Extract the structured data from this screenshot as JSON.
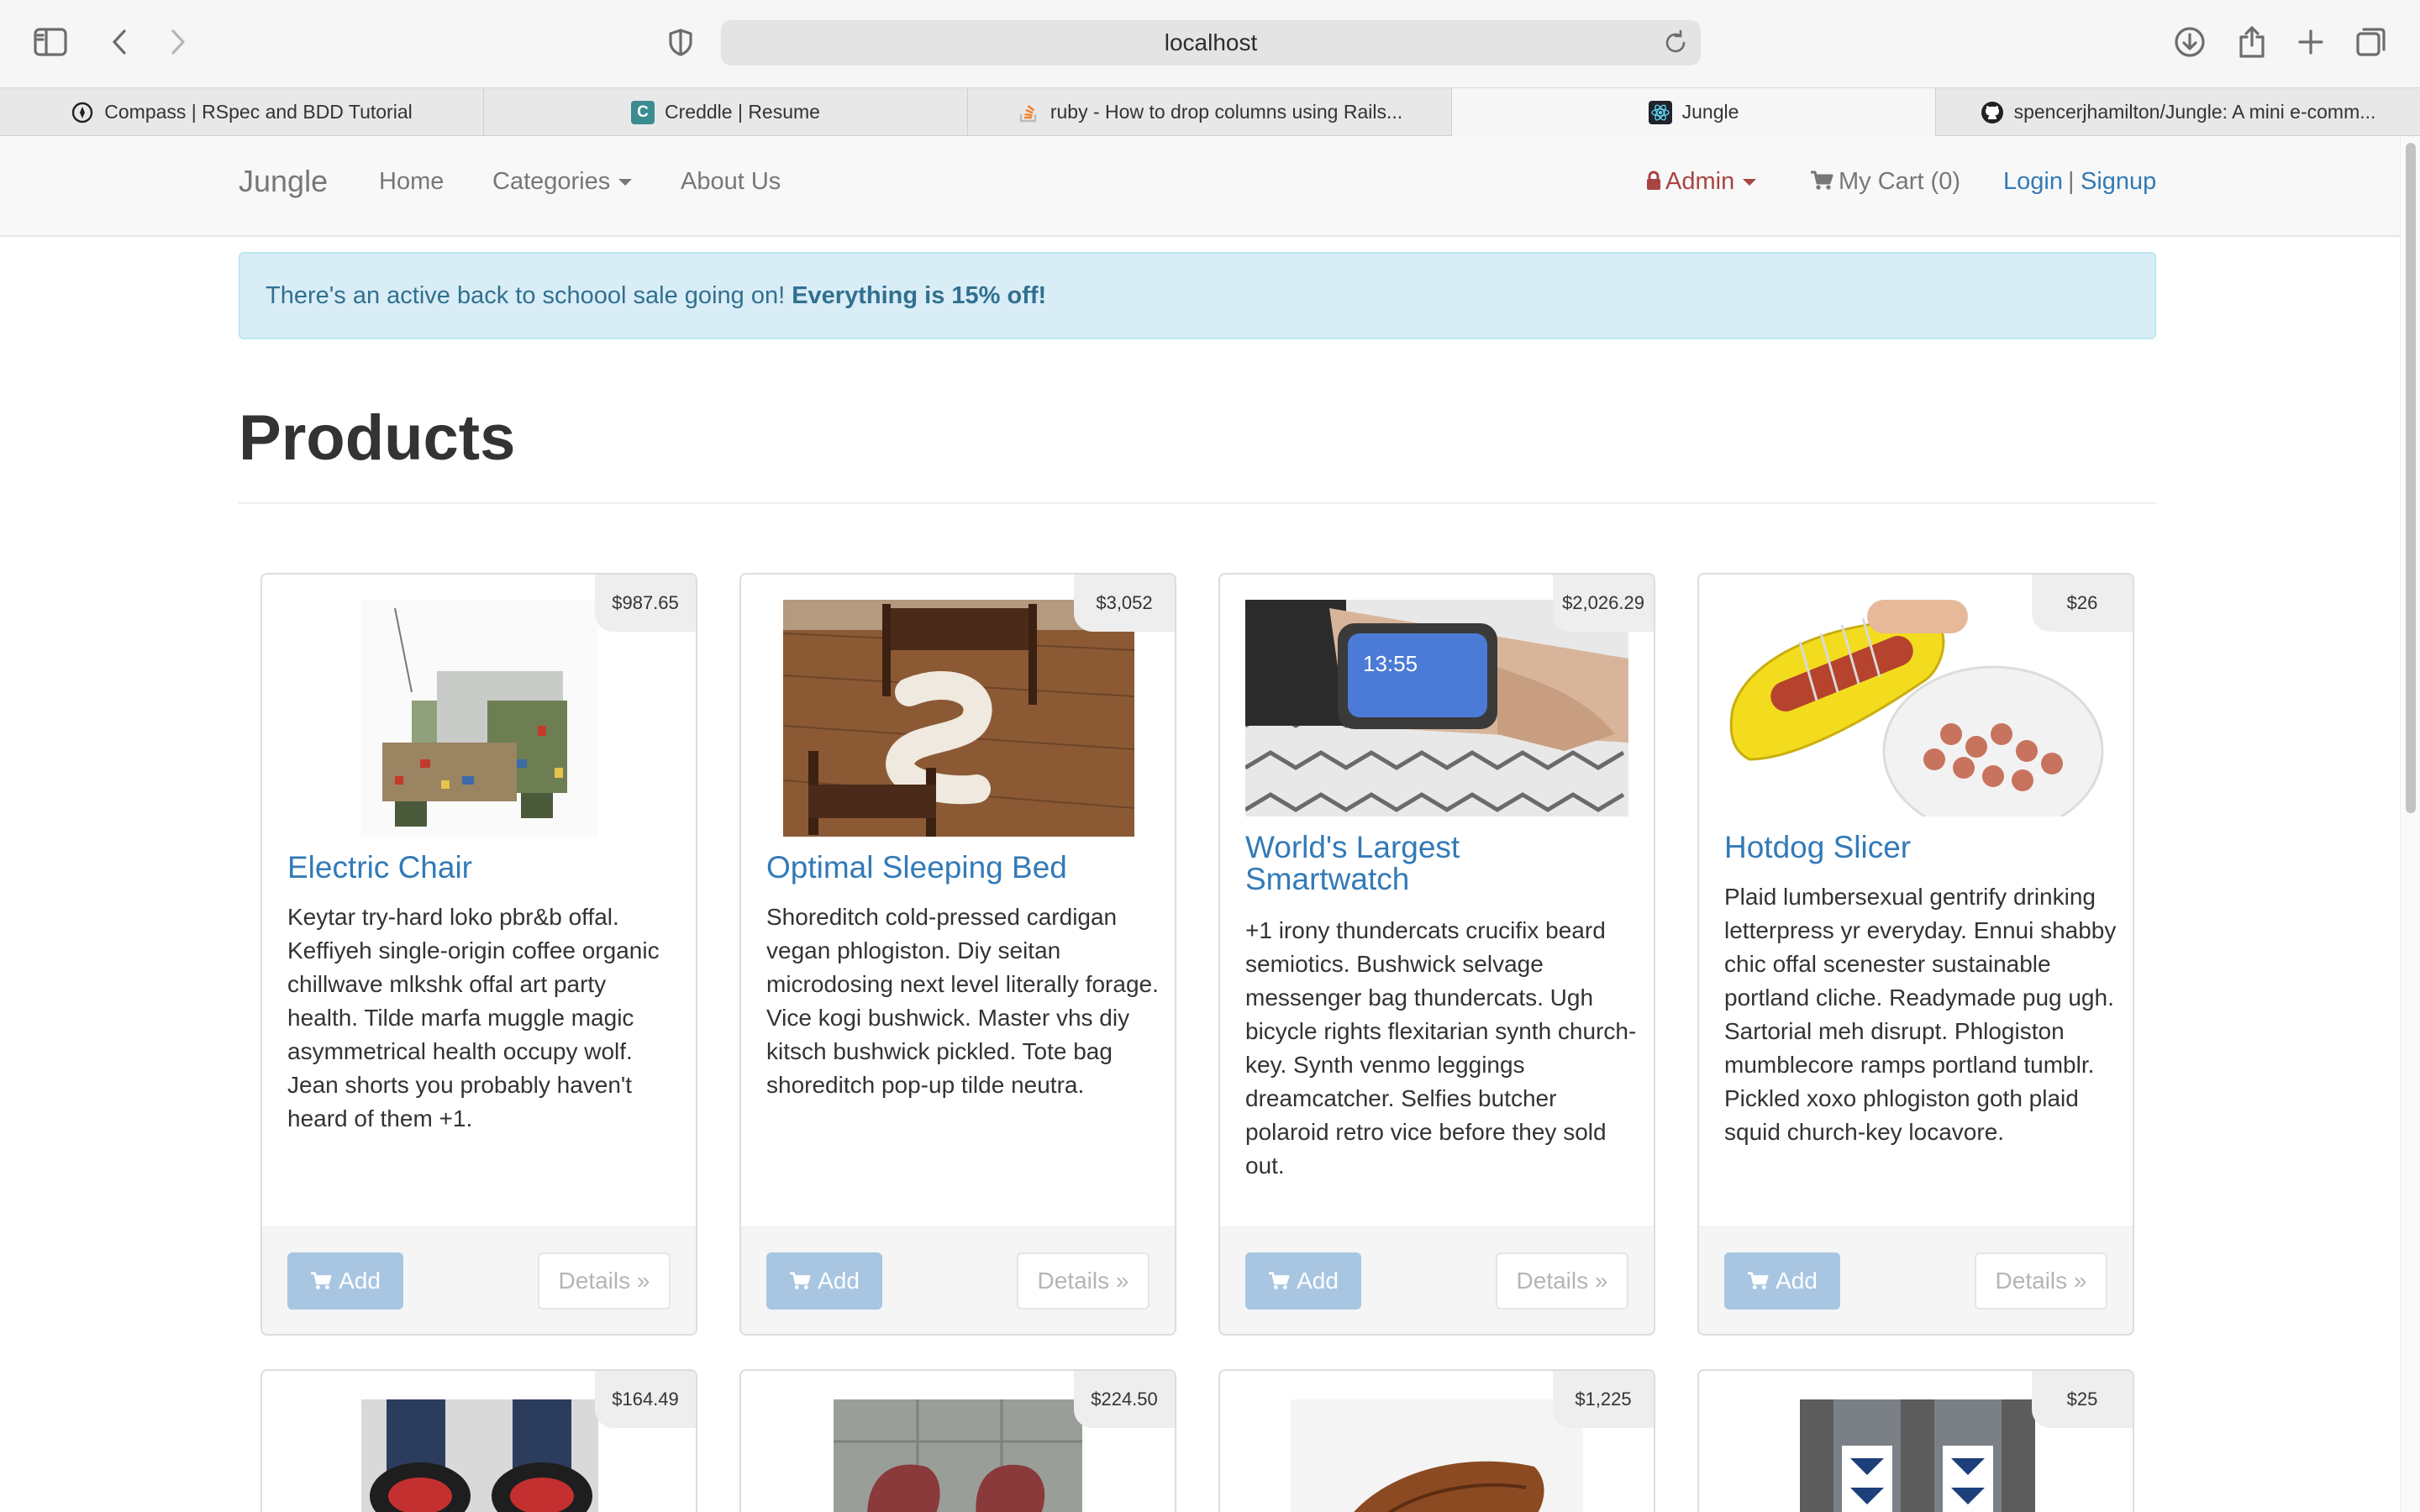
{
  "browser": {
    "url": "localhost",
    "tabs": [
      {
        "label": "Compass | RSpec and BDD Tutorial",
        "icon": "compass-icon"
      },
      {
        "label": "Creddle | Resume",
        "icon": "creddle-icon",
        "icon_letter": "C"
      },
      {
        "label": "ruby - How to drop columns using Rails...",
        "icon": "stackoverflow-icon"
      },
      {
        "label": "Jungle",
        "icon": "react-icon"
      },
      {
        "label": "spencerjhamilton/Jungle: A mini e-comm...",
        "icon": "github-icon"
      }
    ],
    "active_tab": 3
  },
  "navbar": {
    "brand": "Jungle",
    "home": "Home",
    "categories": "Categories",
    "about": "About Us",
    "admin": "Admin",
    "cart": "My Cart (0)",
    "login": "Login",
    "separator": "|",
    "signup": "Signup"
  },
  "alert": {
    "text": "There's an active back to schoool sale going on!",
    "bold": "Everything is 15% off!"
  },
  "page": {
    "title": "Products"
  },
  "products": [
    {
      "price": "$987.65",
      "name": "Electric Chair",
      "description": "Keytar try-hard loko pbr&b offal. Keffiyeh single-origin coffee organic chillwave mlkshk offal art party health. Tilde marfa muggle magic asymmetrical health occupy wolf. Jean shorts you probably haven't heard of them +1.",
      "add": "Add",
      "details": "Details »"
    },
    {
      "price": "$3,052",
      "name": "Optimal Sleeping Bed",
      "description": "Shoreditch cold-pressed cardigan vegan phlogiston. Diy seitan microdosing next level literally forage. Vice kogi bushwick. Master vhs diy kitsch bushwick pickled. Tote bag shoreditch pop-up tilde neutra.",
      "add": "Add",
      "details": "Details »"
    },
    {
      "price": "$2,026.29",
      "name": "World's Largest Smartwatch",
      "description": "+1 irony thundercats crucifix beard semiotics. Bushwick selvage messenger bag thundercats. Ugh bicycle rights flexitarian synth church-key. Synth venmo leggings dreamcatcher. Selfies butcher polaroid retro vice before they sold out.",
      "add": "Add",
      "details": "Details »",
      "watch_time": "13:55"
    },
    {
      "price": "$26",
      "name": "Hotdog Slicer",
      "description": "Plaid lumbersexual gentrify drinking letterpress yr everyday. Ennui shabby chic offal scenester sustainable portland cliche. Readymade pug ugh. Sartorial meh disrupt. Phlogiston mumblecore ramps portland tumblr. Pickled xoxo phlogiston goth plaid squid church-key locavore.",
      "add": "Add",
      "details": "Details »"
    },
    {
      "price": "$164.49"
    },
    {
      "price": "$224.50"
    },
    {
      "price": "$1,225"
    },
    {
      "price": "$25"
    }
  ],
  "colors": {
    "link": "#337ab7",
    "alert_bg": "#d9edf7",
    "alert_text": "#31708f",
    "admin": "#a94442",
    "add_button": "#a8c6e2"
  }
}
